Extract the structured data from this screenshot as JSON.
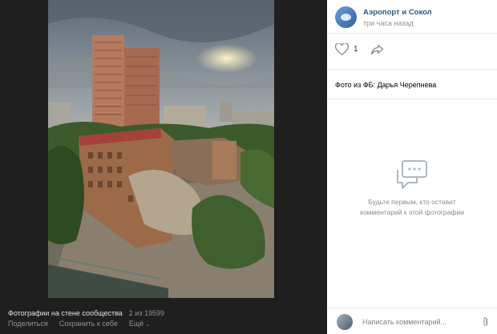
{
  "post": {
    "group_name": "Аэропорт и Сокол",
    "time": "три часа назад",
    "likes_count": "1",
    "description": "Фото из ФБ: Дарья Черепнева"
  },
  "comments": {
    "empty_text": "Будьте первым, кто оставит\nкомментарий к этой фотографии",
    "input_placeholder": "Написать комментарий..."
  },
  "viewer": {
    "album_title": "Фотографии на стене сообщества",
    "counter": "2 из 19599",
    "share_label": "Поделиться",
    "save_label": "Сохранить к себе",
    "more_label": "Ещё"
  },
  "icons": {
    "like": "heart-icon",
    "share": "share-arrow-icon",
    "comments_empty": "speech-bubbles-icon",
    "attach": "paperclip-icon"
  },
  "colors": {
    "link": "#2a5885",
    "muted": "#939393",
    "viewer_bg": "#1f1f1f"
  }
}
